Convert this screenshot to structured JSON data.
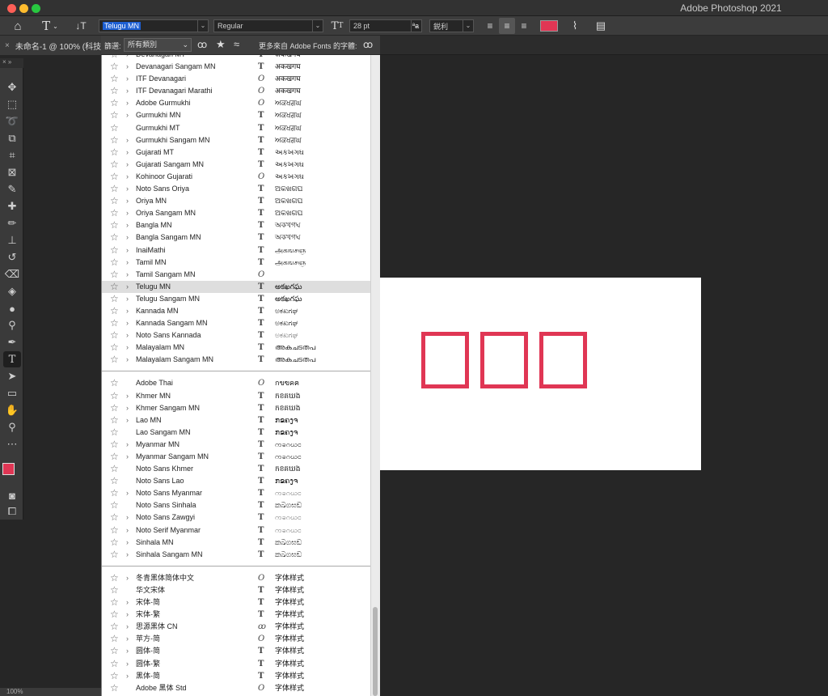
{
  "app": {
    "title": "Adobe Photoshop 2021"
  },
  "options_bar": {
    "font_family_value": "Telugu MN",
    "font_style_value": "Regular",
    "font_size_value": "28 pt",
    "aa_label": "ªa",
    "antialias_value": "鋭利",
    "color_swatch": "#e03654"
  },
  "document_tab": {
    "label": "未命名-1 @ 100% (科技"
  },
  "filter_bar": {
    "filter_label": "篩選:",
    "filter_value": "所有類別",
    "more_fonts_label": "更多來自 Adobe Fonts 的字體:"
  },
  "fonts": {
    "group1": [
      {
        "name": "Devanagari MT",
        "chevron": true,
        "type": "tt",
        "sample": "अकखगघ"
      },
      {
        "name": "Devanagari Sangam MN",
        "chevron": true,
        "type": "tt",
        "sample": "अकखगघ"
      },
      {
        "name": "ITF Devanagari",
        "chevron": true,
        "type": "ot",
        "sample": "अकखगघ"
      },
      {
        "name": "ITF Devanagari Marathi",
        "chevron": true,
        "type": "ot",
        "sample": "अकखगघ"
      },
      {
        "name": "Adobe Gurmukhi",
        "chevron": true,
        "type": "ot",
        "sample": "ਅਕਖਗਘ"
      },
      {
        "name": "Gurmukhi MN",
        "chevron": true,
        "type": "tt",
        "sample": "ਅਕਖਗਘ"
      },
      {
        "name": "Gurmukhi MT",
        "chevron": false,
        "type": "tt",
        "sample": "ਅਕਖਗਘ"
      },
      {
        "name": "Gurmukhi Sangam MN",
        "chevron": true,
        "type": "tt",
        "sample": "ਅਕਖਗਘ"
      },
      {
        "name": "Gujarati MT",
        "chevron": true,
        "type": "tt",
        "sample": "અકખગઘ"
      },
      {
        "name": "Gujarati Sangam MN",
        "chevron": true,
        "type": "tt",
        "sample": "અકખગઘ"
      },
      {
        "name": "Kohinoor Gujarati",
        "chevron": true,
        "type": "ot",
        "sample": "અકખગઘ"
      },
      {
        "name": "Noto Sans Oriya",
        "chevron": true,
        "type": "tt",
        "sample": "ଅକଖଗଘ"
      },
      {
        "name": "Oriya MN",
        "chevron": true,
        "type": "tt",
        "sample": "ଅକଖଗଘ"
      },
      {
        "name": "Oriya Sangam MN",
        "chevron": true,
        "type": "tt",
        "sample": "ଅକଖଗଘ"
      },
      {
        "name": "Bangla MN",
        "chevron": true,
        "type": "tt",
        "sample": "অকখগঘ"
      },
      {
        "name": "Bangla Sangam MN",
        "chevron": true,
        "type": "tt",
        "sample": "অকখগঘ"
      },
      {
        "name": "InaiMathi",
        "chevron": true,
        "type": "tt",
        "sample": "அகஙசஞ"
      },
      {
        "name": "Tamil MN",
        "chevron": true,
        "type": "tt",
        "sample": "அகஙசஞ"
      },
      {
        "name": "Tamil Sangam MN",
        "chevron": true,
        "type": "ot",
        "sample": ""
      },
      {
        "name": "Telugu MN",
        "chevron": true,
        "type": "tt",
        "sample": "అకఖగఘ",
        "selected": true
      },
      {
        "name": "Telugu Sangam MN",
        "chevron": true,
        "type": "tt",
        "sample": "అకఖగఘ"
      },
      {
        "name": "Kannada MN",
        "chevron": true,
        "type": "tt",
        "sample": "ಅಕಖಗಘ"
      },
      {
        "name": "Kannada Sangam MN",
        "chevron": true,
        "type": "tt",
        "sample": "ಅಕಖಗಘ"
      },
      {
        "name": "Noto Sans Kannada",
        "chevron": true,
        "type": "tt",
        "sample": "ಅಕಖಗಘ",
        "light": true
      },
      {
        "name": "Malayalam MN",
        "chevron": true,
        "type": "tt",
        "sample": "അകചടതപ"
      },
      {
        "name": "Malayalam Sangam MN",
        "chevron": true,
        "type": "tt",
        "sample": "അകചടതപ"
      }
    ],
    "group2": [
      {
        "name": "Adobe Thai",
        "chevron": false,
        "type": "ot",
        "sample": "กขฃคฅ"
      },
      {
        "name": "Khmer MN",
        "chevron": true,
        "type": "tt",
        "sample": "កខគឃង"
      },
      {
        "name": "Khmer Sangam MN",
        "chevron": true,
        "type": "tt",
        "sample": "កខគឃង"
      },
      {
        "name": "Lao MN",
        "chevron": true,
        "type": "tt",
        "sample": "ກຂຄງຈ"
      },
      {
        "name": "Lao Sangam MN",
        "chevron": false,
        "type": "tt",
        "sample": "ກຂຄງຈ"
      },
      {
        "name": "Myanmar MN",
        "chevron": true,
        "type": "tt",
        "sample": "ကခဂဃင"
      },
      {
        "name": "Myanmar Sangam MN",
        "chevron": true,
        "type": "tt",
        "sample": "ကခဂဃင"
      },
      {
        "name": "Noto Sans Khmer",
        "chevron": false,
        "type": "tt",
        "sample": "កខគឃង"
      },
      {
        "name": "Noto Sans Lao",
        "chevron": false,
        "type": "tt",
        "sample": "ກຂຄງຈ"
      },
      {
        "name": "Noto Sans Myanmar",
        "chevron": true,
        "type": "tt",
        "sample": "ကခဂဃင",
        "light": true
      },
      {
        "name": "Noto Sans Sinhala",
        "chevron": false,
        "type": "tt",
        "sample": "කඛගඝඞ"
      },
      {
        "name": "Noto Sans Zawgyi",
        "chevron": true,
        "type": "tt",
        "sample": "ကခဂဃင",
        "light": true
      },
      {
        "name": "Noto Serif Myanmar",
        "chevron": true,
        "type": "tt",
        "sample": "ကခဂဃင",
        "light": true
      },
      {
        "name": "Sinhala MN",
        "chevron": true,
        "type": "tt",
        "sample": "කඛගඝඞ"
      },
      {
        "name": "Sinhala Sangam MN",
        "chevron": true,
        "type": "tt",
        "sample": "කඛගඝඞ"
      }
    ],
    "group3": [
      {
        "name": "冬青黑体简体中文",
        "chevron": true,
        "type": "ot",
        "sample": "字体样式"
      },
      {
        "name": "华文宋体",
        "chevron": false,
        "type": "tt",
        "sample": "字体样式"
      },
      {
        "name": "宋体-简",
        "chevron": true,
        "type": "tt",
        "sample": "字体样式"
      },
      {
        "name": "宋体-繁",
        "chevron": true,
        "type": "tt",
        "sample": "字体样式"
      },
      {
        "name": "思源黑体 CN",
        "chevron": true,
        "type": "cc",
        "sample": "字体样式"
      },
      {
        "name": "苹方-简",
        "chevron": true,
        "type": "ot",
        "sample": "字体样式"
      },
      {
        "name": "圆体-简",
        "chevron": true,
        "type": "tt",
        "sample": "字体样式"
      },
      {
        "name": "圆体-繁",
        "chevron": true,
        "type": "tt",
        "sample": "字体样式"
      },
      {
        "name": "黑体-简",
        "chevron": true,
        "type": "tt",
        "sample": "字体样式"
      },
      {
        "name": "Adobe 黑体 Std",
        "chevron": false,
        "type": "ot",
        "sample": "字体样式"
      }
    ]
  },
  "status": {
    "zoom": "100%"
  }
}
